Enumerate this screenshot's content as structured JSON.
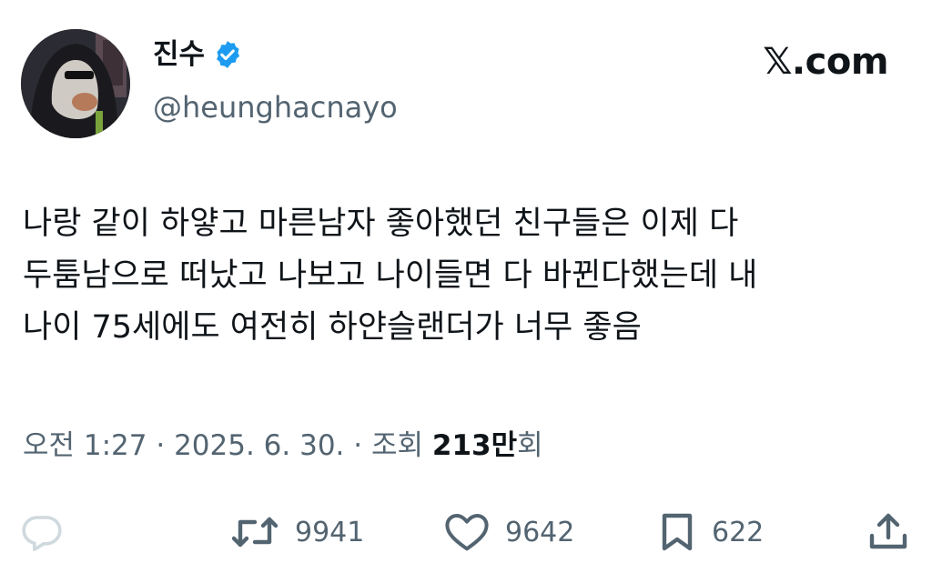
{
  "author": {
    "display_name": "진수",
    "handle": "@heunghacnayo",
    "avatar_icon": "profile-avatar",
    "verified_icon": "verified-badge-icon",
    "verified_color": "#1d9bf0"
  },
  "brand": {
    "label": "𝕏.com"
  },
  "tweet": {
    "lines": [
      "나랑 같이 하얗고 마른남자 좋아했던 친구들은 이제 다",
      "두툼남으로 떠났고 나보고 나이들면 다 바뀐다했는데 내",
      "나이 75세에도 여전히 하얀슬랜더가 너무 좋음"
    ]
  },
  "meta": {
    "time": "오전 1:27",
    "separator": " · ",
    "date": "2025. 6. 30.",
    "views_label": "조회",
    "views_count": "213만",
    "views_suffix": "회"
  },
  "actions": {
    "reply": {
      "icon": "reply-icon",
      "count": ""
    },
    "retweet": {
      "icon": "retweet-icon",
      "count": "9941"
    },
    "like": {
      "icon": "heart-icon",
      "count": "9642"
    },
    "bookmark": {
      "icon": "bookmark-icon",
      "count": "622"
    },
    "share": {
      "icon": "share-icon"
    }
  },
  "colors": {
    "text_primary": "#0f1419",
    "text_secondary": "#536471",
    "reply_icon": "#cfd9de"
  }
}
